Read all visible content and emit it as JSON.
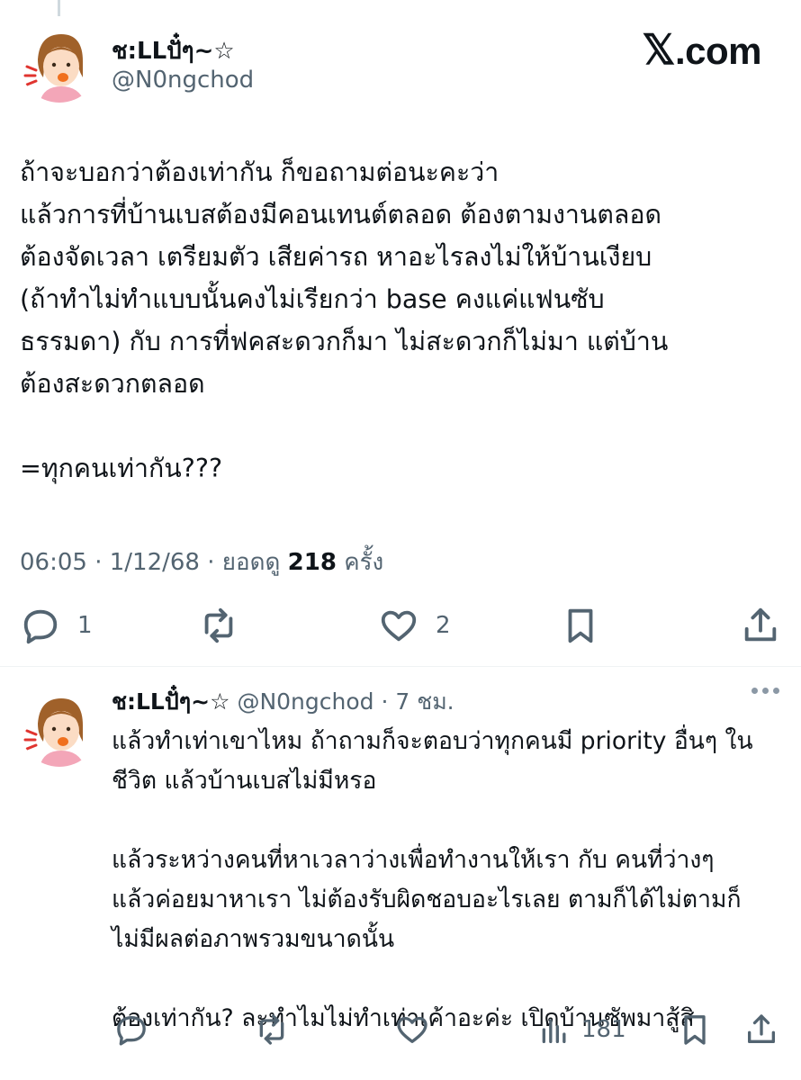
{
  "brand": {
    "prefix": "𝕏",
    "suffix": ".com"
  },
  "main_tweet": {
    "display_name": "ช:LLปั๋ๆ~☆",
    "handle": "@N0ngchod",
    "text": "ถ้าจะบอกว่าต้องเท่ากัน ก็ขอถามต่อนะคะว่า\nแล้วการที่บ้านเบสต้องมีคอนเทนต์ตลอด ต้องตามงานตลอด\nต้องจัดเวลา เตรียมตัว เสียค่ารถ หาอะไรลงไม่ให้บ้านเงียบ\n(ถ้าทำไม่ทำแบบนั้นคงไม่เรียกว่า base คงแค่แฟนซับ\nธรรมดา) กับ การที่ฟคสะดวกก็มา ไม่สะดวกก็ไม่มา แต่บ้าน\nต้องสะดวกตลอด\n\n=ทุกคนเท่ากัน???",
    "time": "06:05",
    "date": "1/12/68",
    "views_label": "ยอดดู",
    "views_count": "218",
    "views_suffix": "ครั้ง",
    "actions": {
      "replies": "1",
      "likes": "2"
    }
  },
  "reply_tweet": {
    "display_name": "ช:LLปั๋ๆ~☆",
    "handle": "@N0ngchod",
    "age": "7 ชม.",
    "text": "แล้วทำเท่าเขาไหม ถ้าถามก็จะตอบว่าทุกคนมี priority อื่นๆ ใน\nชีวิต แล้วบ้านเบสไม่มีหรอ\n\nแล้วระหว่างคนที่หาเวลาว่างเพื่อทำงานให้เรา กับ คนที่ว่างๆ\nแล้วค่อยมาหาเรา ไม่ต้องรับผิดชอบอะไรเลย ตามก็ได้ไม่ตามก็\nไม่มีผลต่อภาพรวมขนาดนั้น\n\nต้องเท่ากัน? ละทำไมไม่ทำเท่าเค้าอะค่ะ เปิดบ้านซัพมาสู้สิ",
    "actions": {
      "views": "181"
    }
  },
  "icons": [
    "reply-icon",
    "repost-icon",
    "like-icon",
    "bookmark-icon",
    "share-icon",
    "views-icon",
    "more-icon"
  ],
  "colors": {
    "text": "#0f1419",
    "secondary": "#536471",
    "divider": "#eff3f4"
  }
}
